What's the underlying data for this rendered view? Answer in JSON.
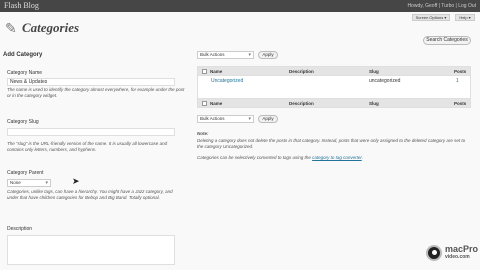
{
  "adminbar": {
    "site_name": "Flash Blog",
    "howdy": "Howdy, Geoff | Turbo | Log Out"
  },
  "screen_options": "Screen Options ▾",
  "help": "Help ▾",
  "page": {
    "title": "Categories"
  },
  "search_button": "Search Categories",
  "form": {
    "heading": "Add Category",
    "name_label": "Category Name",
    "name_value": "News & Updates",
    "name_help": "The name is used to identify the category almost everywhere, for example under the post or in the category widget.",
    "slug_label": "Category Slug",
    "slug_help": "The “slug” is the URL-friendly version of the name. It is usually all lowercase and contains only letters, numbers, and hyphens.",
    "parent_label": "Category Parent",
    "parent_value": "None",
    "parent_help": "Categories, unlike tags, can have a hierarchy. You might have a Jazz category, and under that have children categories for Bebop and Big Band. Totally optional.",
    "description_label": "Description"
  },
  "bulk_top": {
    "select": "Bulk Actions",
    "apply": "Apply"
  },
  "bulk_bottom": {
    "select": "Bulk Actions",
    "apply": "Apply"
  },
  "table": {
    "columns": [
      "Name",
      "Description",
      "Slug",
      "Posts"
    ],
    "rows": [
      {
        "name": "Uncategorized",
        "description": "",
        "slug": "uncategorized",
        "posts": "1"
      }
    ]
  },
  "note": {
    "heading": "Note:",
    "text": "Deleting a category does not delete the posts in that category. Instead, posts that were only assigned to the deleted category are set to the category Uncategorized.",
    "convert_prefix": "Categories can be selectively converted to tags using the",
    "convert_link": "category to tag converter",
    "convert_suffix": "."
  },
  "watermark": {
    "brand_top": "macPro",
    "brand_bottom": "video.com"
  }
}
